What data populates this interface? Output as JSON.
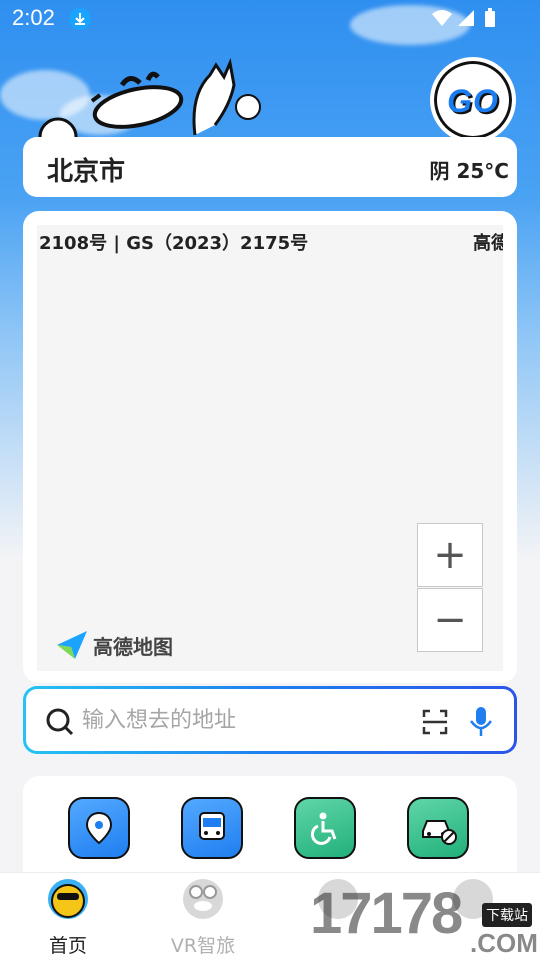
{
  "status_bar": {
    "time": "2:02"
  },
  "header": {
    "go_badge": "GO"
  },
  "city_card": {
    "city": "北京市",
    "weather": "阴 25°C"
  },
  "map": {
    "license_text": "2108号 | GS（2023）2175号",
    "provider_top": "高德",
    "zoom_in": "+",
    "zoom_out": "−",
    "logo_text": "高德地图"
  },
  "search": {
    "placeholder": "输入想去的地址",
    "value": ""
  },
  "quick_actions": [
    {
      "icon": "location-pin-icon",
      "color": "#2f7df0"
    },
    {
      "icon": "bus-icon",
      "color": "#2f7df0"
    },
    {
      "icon": "wheelchair-icon",
      "color": "#22b07a"
    },
    {
      "icon": "no-car-icon",
      "color": "#22b07a"
    }
  ],
  "bottom_nav": {
    "items": [
      {
        "label": "首页",
        "active": true
      },
      {
        "label": "VR智旅",
        "active": false
      },
      {
        "label": "",
        "active": false
      },
      {
        "label": "",
        "active": false
      }
    ]
  },
  "watermark": {
    "text": "17178",
    "tag": "下载站",
    "suffix": ".COM"
  },
  "colors": {
    "primary": "#1f7ef0",
    "accent_green": "#22b07a",
    "sky": "#2f8ff0"
  }
}
